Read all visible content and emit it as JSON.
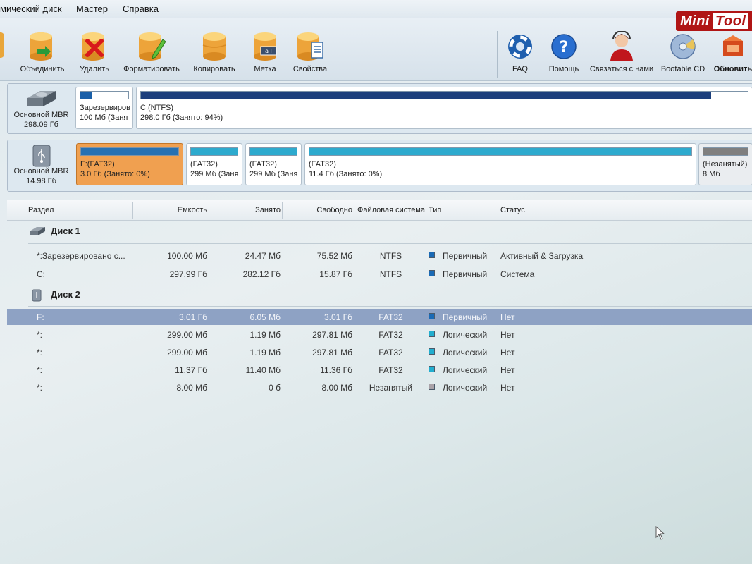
{
  "menu": {
    "items": [
      "мический диск",
      "Мастер",
      "Справка"
    ]
  },
  "brand": {
    "text1": "Mini",
    "text2": "Tool"
  },
  "toolbar": {
    "left": [
      {
        "label": "Объединить",
        "icon": "merge-icon"
      },
      {
        "label": "Удалить",
        "icon": "delete-icon"
      },
      {
        "label": "Форматировать",
        "icon": "format-icon"
      },
      {
        "label": "Копировать",
        "icon": "copy-icon"
      },
      {
        "label": "Метка",
        "icon": "label-icon"
      },
      {
        "label": "Свойства",
        "icon": "properties-icon"
      }
    ],
    "right": [
      {
        "label": "FAQ",
        "icon": "lifebuoy-icon"
      },
      {
        "label": "Помощь",
        "icon": "help-icon"
      },
      {
        "label": "Связаться с нами",
        "icon": "contact-icon"
      },
      {
        "label": "Bootable CD",
        "icon": "cd-icon"
      },
      {
        "label": "Обновить",
        "icon": "update-icon"
      }
    ]
  },
  "diskmap": {
    "disk1": {
      "type": "Основной MBR",
      "size": "298.09 Гб",
      "partitions": [
        {
          "line1": "Зарезервиров",
          "line2": "100 Мб (Заня",
          "usage": 0.25,
          "color": "#1a5fa8"
        },
        {
          "line1": "C:(NTFS)",
          "line2": "298.0 Гб (Занято: 94%)",
          "usage": 0.94,
          "color": "#1c3f7c"
        }
      ]
    },
    "disk2": {
      "type": "Основной MBR",
      "size": "14.98 Гб",
      "partitions": [
        {
          "line1": "F:(FAT32)",
          "line2": "3.0 Гб (Занято: 0%)",
          "usage": 0.0,
          "color": "#1d6fb8"
        },
        {
          "line1": "(FAT32)",
          "line2": "299 Мб (Заня",
          "usage": 0.0,
          "color": "#22a6cc"
        },
        {
          "line1": "(FAT32)",
          "line2": "299 Мб (Заня",
          "usage": 0.0,
          "color": "#22a6cc"
        },
        {
          "line1": "(FAT32)",
          "line2": "11.4 Гб (Занято: 0%)",
          "usage": 0.0,
          "color": "#22a6cc"
        },
        {
          "line1": "(Незанятый)",
          "line2": "8 Мб",
          "usage": 0.0,
          "color": "#7a7a7a"
        }
      ]
    }
  },
  "table": {
    "headers": [
      "Раздел",
      "Емкость",
      "Занято",
      "Свободно",
      "Файловая система",
      "Тип",
      "Статус"
    ],
    "groups": [
      {
        "name": "Диск 1",
        "rows": [
          {
            "partition": "*:Зарезервировано с...",
            "capacity": "100.00 Мб",
            "used": "24.47 Мб",
            "free": "75.52 Мб",
            "fs": "NTFS",
            "type": "Первичный",
            "status": "Активный & Загрузка",
            "color": "#1a6ab5"
          },
          {
            "partition": "C:",
            "capacity": "297.99 Гб",
            "used": "282.12 Гб",
            "free": "15.87 Гб",
            "fs": "NTFS",
            "type": "Первичный",
            "status": "Система",
            "color": "#1a6ab5"
          }
        ]
      },
      {
        "name": "Диск 2",
        "rows": [
          {
            "partition": "F:",
            "capacity": "3.01 Гб",
            "used": "6.05 Мб",
            "free": "3.01 Гб",
            "fs": "FAT32",
            "type": "Первичный",
            "status": "Нет",
            "color": "#1a6ab5",
            "selected": true
          },
          {
            "partition": "*:",
            "capacity": "299.00 Мб",
            "used": "1.19 Мб",
            "free": "297.81 Мб",
            "fs": "FAT32",
            "type": "Логический",
            "status": "Нет",
            "color": "#22aecf"
          },
          {
            "partition": "*:",
            "capacity": "299.00 Мб",
            "used": "1.19 Мб",
            "free": "297.81 Мб",
            "fs": "FAT32",
            "type": "Логический",
            "status": "Нет",
            "color": "#22aecf"
          },
          {
            "partition": "*:",
            "capacity": "11.37 Гб",
            "used": "11.40 Мб",
            "free": "11.36 Гб",
            "fs": "FAT32",
            "type": "Логический",
            "status": "Нет",
            "color": "#22aecf"
          },
          {
            "partition": "*:",
            "capacity": "8.00 Мб",
            "used": "0 б",
            "free": "8.00 Мб",
            "fs": "Незанятый",
            "type": "Логический",
            "status": "Нет",
            "color": "#a9a2a8"
          }
        ]
      }
    ]
  }
}
